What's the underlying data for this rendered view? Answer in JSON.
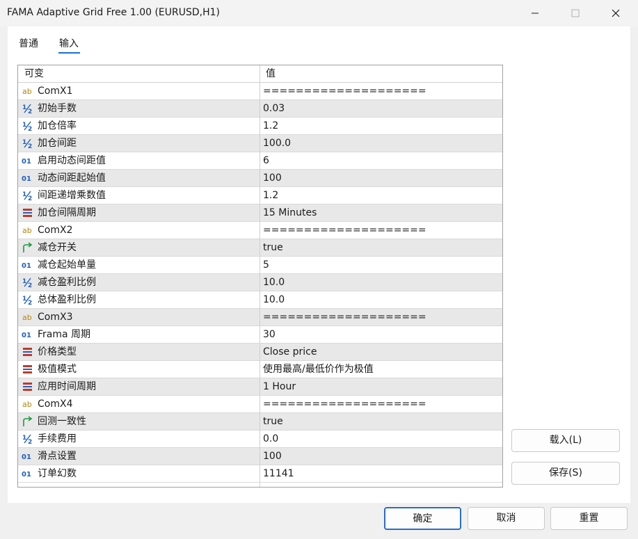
{
  "window": {
    "title": "FAMA Adaptive Grid Free 1.00 (EURUSD,H1)",
    "controls": [
      "minimize-icon",
      "maximize-icon",
      "close-icon"
    ]
  },
  "tabs": [
    {
      "label": "普通",
      "active": false
    },
    {
      "label": "输入",
      "active": true
    }
  ],
  "grid": {
    "headers": {
      "variable": "可变",
      "value": "值"
    },
    "rows": [
      {
        "icon": "string-icon",
        "name": "ComX1",
        "value": "===================="
      },
      {
        "icon": "double-icon",
        "name": "初始手数",
        "value": "0.03"
      },
      {
        "icon": "double-icon",
        "name": "加仓倍率",
        "value": "1.2"
      },
      {
        "icon": "double-icon",
        "name": "加仓间距",
        "value": "100.0"
      },
      {
        "icon": "integer-icon",
        "name": "启用动态间距值",
        "value": "6"
      },
      {
        "icon": "integer-icon",
        "name": "动态间距起始值",
        "value": "100"
      },
      {
        "icon": "double-icon",
        "name": "间距递增乘数值",
        "value": "1.2"
      },
      {
        "icon": "enum-icon",
        "name": "加仓间隔周期",
        "value": "15 Minutes"
      },
      {
        "icon": "string-icon",
        "name": "ComX2",
        "value": "===================="
      },
      {
        "icon": "bool-icon",
        "name": "减仓开关",
        "value": "true"
      },
      {
        "icon": "integer-icon",
        "name": "减仓起始单量",
        "value": "5"
      },
      {
        "icon": "double-icon",
        "name": "减仓盈利比例",
        "value": "10.0"
      },
      {
        "icon": "double-icon",
        "name": "总体盈利比例",
        "value": "10.0"
      },
      {
        "icon": "string-icon",
        "name": "ComX3",
        "value": "===================="
      },
      {
        "icon": "integer-icon",
        "name": "Frama 周期",
        "value": "30"
      },
      {
        "icon": "enum-icon",
        "name": "价格类型",
        "value": "Close price"
      },
      {
        "icon": "enum-icon",
        "name": "极值模式",
        "value": "使用最高/最低价作为极值"
      },
      {
        "icon": "enum-icon",
        "name": "应用时间周期",
        "value": "1 Hour"
      },
      {
        "icon": "string-icon",
        "name": "ComX4",
        "value": "===================="
      },
      {
        "icon": "bool-icon",
        "name": "回测一致性",
        "value": "true"
      },
      {
        "icon": "double-icon",
        "name": "手续费用",
        "value": "0.0"
      },
      {
        "icon": "integer-icon",
        "name": "滑点设置",
        "value": "100"
      },
      {
        "icon": "integer-icon",
        "name": "订单幻数",
        "value": "11141"
      }
    ]
  },
  "side_buttons": {
    "load": "载入(L)",
    "save": "保存(S)"
  },
  "buttons": {
    "ok": "确定",
    "cancel": "取消",
    "reset": "重置"
  },
  "colors": {
    "accent": "#1a6fd1",
    "row_alt": "#e8e8e8",
    "string_icon": "#b8860b",
    "number_icon": "#1f5fbf",
    "bool_icon": "#1a9a3a",
    "enum_icon": "#c0392b"
  }
}
